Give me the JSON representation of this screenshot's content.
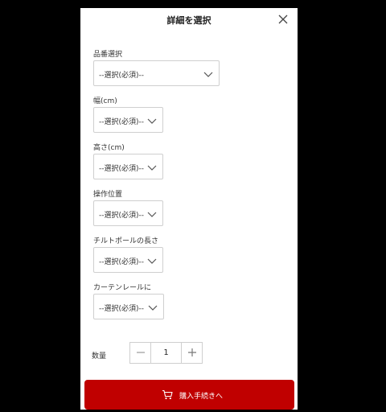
{
  "modal": {
    "title": "詳細を選択",
    "close_icon": "close-icon"
  },
  "fields": [
    {
      "label": "品番選択",
      "value": "--選択(必須)--"
    },
    {
      "label": "幅(cm)",
      "value": "--選択(必須)--"
    },
    {
      "label": "高さ(cm)",
      "value": "--選択(必須)--"
    },
    {
      "label": "操作位置",
      "value": "--選択(必須)--"
    },
    {
      "label": "チルトポールの長さ",
      "value": "--選択(必須)--"
    },
    {
      "label": "カーテンレールに",
      "value": "--選択(必須)--"
    }
  ],
  "quantity": {
    "label": "数量",
    "value": "1",
    "minus_icon": "minus-icon",
    "plus_icon": "plus-icon"
  },
  "checkout": {
    "label": "購入手続きへ",
    "icon": "cart-icon",
    "color": "#c00000"
  }
}
